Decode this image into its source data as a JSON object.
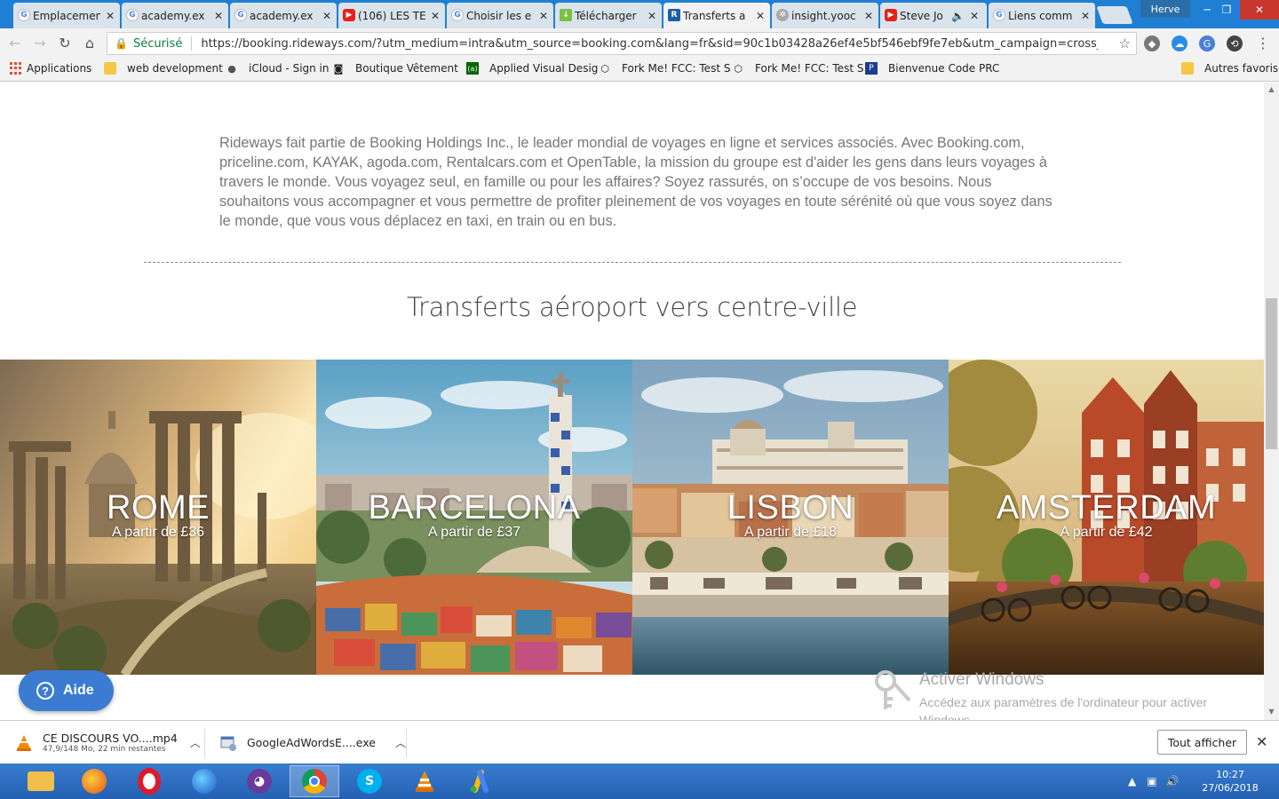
{
  "browser": {
    "tabs": [
      {
        "title": "Emplacement",
        "icon": "google-icon",
        "active": false
      },
      {
        "title": "academy.ex",
        "icon": "google-icon",
        "active": false
      },
      {
        "title": "academy.ex",
        "icon": "google-icon",
        "active": false
      },
      {
        "title": "(106) LES TE",
        "icon": "youtube-icon",
        "active": false
      },
      {
        "title": "Choisir les e",
        "icon": "google-icon",
        "active": false
      },
      {
        "title": "Télécharger",
        "icon": "download-icon",
        "active": false
      },
      {
        "title": "Transferts a",
        "icon": "rideways-icon",
        "active": true
      },
      {
        "title": "insight.yooc",
        "icon": "gear-icon",
        "active": false
      },
      {
        "title": "Steve Jo",
        "icon": "youtube-icon",
        "active": false
      },
      {
        "title": "Liens comm",
        "icon": "google-icon",
        "active": false
      }
    ],
    "user": "Herve",
    "secure_label": "Sécurisé",
    "url": "https://booking.rideways.com/?utm_medium=intra&utm_source=booking.com&lang=fr&sid=90c1b03428a26ef4e5bf546ebf9fe7eb&utm_campaign=cross_product_...",
    "bookmarks": [
      {
        "label": "Applications"
      },
      {
        "label": "web development"
      },
      {
        "label": "iCloud - Sign in"
      },
      {
        "label": "Boutique Vêtement"
      },
      {
        "label": "Applied Visual Desig"
      },
      {
        "label": "Fork Me! FCC: Test S"
      },
      {
        "label": "Fork Me! FCC: Test S"
      },
      {
        "label": "Bienvenue Code PRC"
      }
    ],
    "other_bookmarks": "Autres favoris"
  },
  "page": {
    "intro": "Rideways fait partie de Booking Holdings Inc., le leader mondial de voyages en ligne et services associés. Avec Booking.com, priceline.com, KAYAK, agoda.com, Rentalcars.com et OpenTable, la mission du groupe est d'aider les gens dans leurs voyages à travers le monde. Vous voyagez seul, en famille ou pour les affaires? Soyez rassurés, on s’occupe de vos besoins. Nous souhaitons vous accompagner et vous permettre de profiter pleinement de vos voyages en toute sérénité où que vous soyez dans le monde, que vous vous déplacez en taxi, en train ou en bus.",
    "section_title": "Transferts aéroport vers centre-ville",
    "cities": [
      {
        "name": "ROME",
        "price": "A partir de £36"
      },
      {
        "name": "BARCELONA",
        "price": "A partir de £37"
      },
      {
        "name": "LISBON",
        "price": "A partir de £18"
      },
      {
        "name": "AMSTERDAM",
        "price": "A partir de £42"
      }
    ],
    "help_label": "Aide",
    "activate_title": "Activer Windows",
    "activate_text": "Accédez aux paramètres de l'ordinateur pour activer Windows."
  },
  "downloads": {
    "items": [
      {
        "name": "CE DISCOURS VO....mp4",
        "status": "47,9/148 Mo, 22 min restantes"
      },
      {
        "name": "GoogleAdWordsE....exe",
        "status": ""
      }
    ],
    "show_all": "Tout afficher"
  },
  "taskbar": {
    "time": "10:27",
    "date": "27/06/2018"
  },
  "colors": {
    "accent": "#3b7bd1",
    "chrome_title": "#1f7fd4",
    "secure": "#0b8043"
  }
}
